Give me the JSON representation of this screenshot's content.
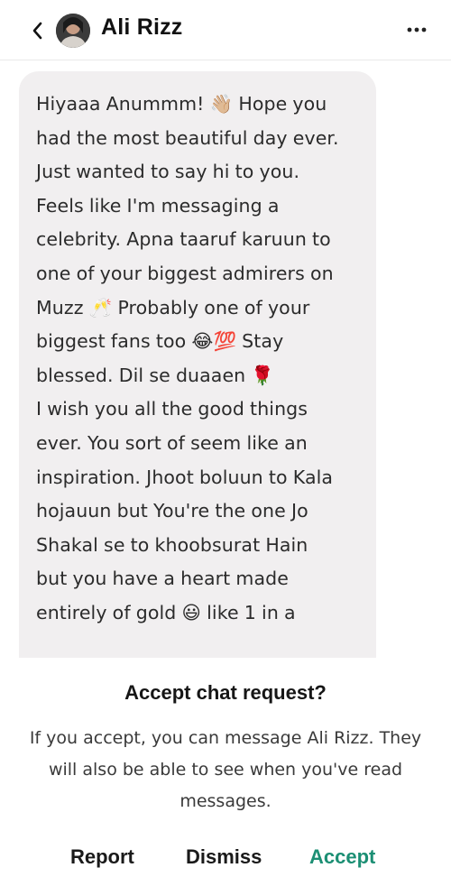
{
  "header": {
    "back_icon": "chevron-left-icon",
    "contact_name": "Ali Rizz",
    "more_icon": "more-horizontal-icon"
  },
  "message": {
    "text": "Hiyaaa Anummm! 👋🏼 Hope you\nhad the most beautiful day ever.\nJust wanted to say hi to you.\nFeels like I'm messaging a\ncelebrity. Apna taaruf karuun to\none of your biggest admirers on\nMuzz 🥂 Probably one of your\nbiggest fans too 😂💯 Stay\nblessed. Dil se duaaen 🌹\nI wish you all the good things\never. You sort of seem like an\ninspiration. Jhoot boluun to Kala\nhojauun but You're the one Jo\nShakal se to khoobsurat Hain\nbut you have a heart made\nentirely of gold 😃 like 1 in a"
  },
  "request_panel": {
    "title": "Accept chat request?",
    "body": "If you accept, you can message Ali Rizz. They will also be able to see when you've read messages.",
    "report_label": "Report",
    "dismiss_label": "Dismiss",
    "accept_label": "Accept"
  },
  "colors": {
    "accent": "#1c8f74",
    "bubble_bg": "#f1eff0",
    "divider": "#e9e9e9"
  }
}
